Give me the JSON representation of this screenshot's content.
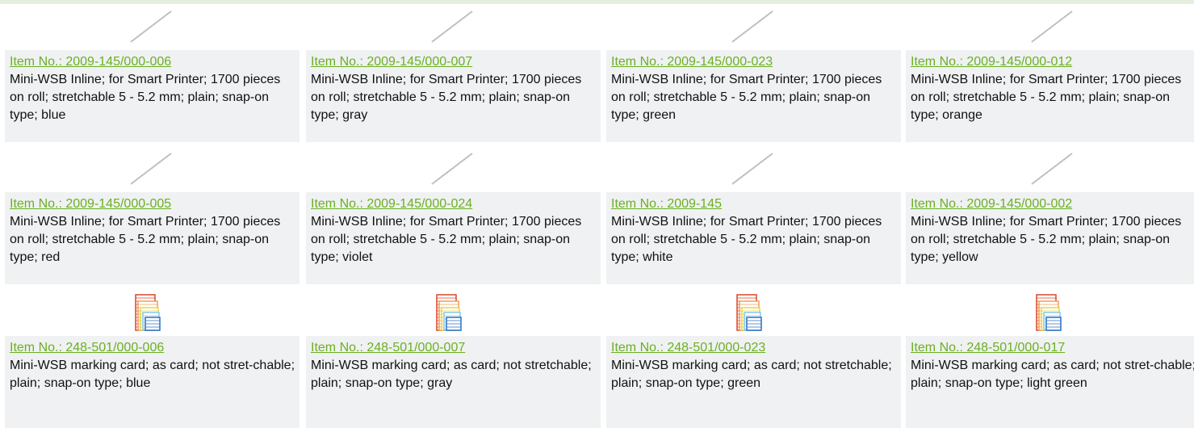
{
  "colors": {
    "link": "#6ab023",
    "card_bg": "#f0f1f2",
    "top_bar": "#e4efe0"
  },
  "products": [
    {
      "item_no": "Item No.: 2009-145/000-006",
      "description": "Mini-WSB Inline; for Smart Printer; 1700 pieces on roll; stretchable 5 - 5.2 mm; plain; snap-on type; blue",
      "thumbnail": "roll-strip-thumbnail"
    },
    {
      "item_no": "Item No.: 2009-145/000-007",
      "description": "Mini-WSB Inline; for Smart Printer; 1700 pieces on roll; stretchable 5 - 5.2 mm; plain; snap-on type; gray",
      "thumbnail": "roll-strip-thumbnail"
    },
    {
      "item_no": "Item No.: 2009-145/000-023",
      "description": "Mini-WSB Inline; for Smart Printer; 1700 pieces on roll; stretchable 5 - 5.2 mm; plain; snap-on type; green",
      "thumbnail": "roll-strip-thumbnail"
    },
    {
      "item_no": "Item No.: 2009-145/000-012",
      "description": "Mini-WSB Inline; for Smart Printer; 1700 pieces on roll; stretchable 5 - 5.2 mm; plain; snap-on type; orange",
      "thumbnail": "roll-strip-thumbnail"
    },
    {
      "item_no": "Item No.: 2009-145/000-005",
      "description": "Mini-WSB Inline; for Smart Printer; 1700 pieces on roll; stretchable 5 - 5.2 mm; plain; snap-on type; red",
      "thumbnail": "roll-strip-thumbnail"
    },
    {
      "item_no": "Item No.: 2009-145/000-024",
      "description": "Mini-WSB Inline; for Smart Printer; 1700 pieces on roll; stretchable 5 - 5.2 mm; plain; snap-on type; violet",
      "thumbnail": "roll-strip-thumbnail"
    },
    {
      "item_no": "Item No.: 2009-145",
      "description": "Mini-WSB Inline; for Smart Printer; 1700 pieces on roll; stretchable 5 - 5.2 mm; plain; snap-on type; white",
      "thumbnail": "roll-strip-thumbnail"
    },
    {
      "item_no": "Item No.: 2009-145/000-002",
      "description": "Mini-WSB Inline; for Smart Printer; 1700 pieces on roll; stretchable 5 - 5.2 mm; plain; snap-on type; yellow",
      "thumbnail": "roll-strip-thumbnail"
    },
    {
      "item_no": "Item No.: 248-501/000-006",
      "description": "Mini-WSB marking card; as card; not stret-chable; plain; snap-on type; blue",
      "thumbnail": "marking-card-thumbnail"
    },
    {
      "item_no": "Item No.: 248-501/000-007",
      "description": "Mini-WSB marking card; as card; not stretchable; plain; snap-on type; gray",
      "thumbnail": "marking-card-thumbnail"
    },
    {
      "item_no": "Item No.: 248-501/000-023",
      "description": "Mini-WSB marking card; as card; not stretchable; plain; snap-on type; green",
      "thumbnail": "marking-card-thumbnail"
    },
    {
      "item_no": "Item No.: 248-501/000-017",
      "description": "Mini-WSB marking card; as card; not stret-chable; plain; snap-on type; light green",
      "thumbnail": "marking-card-thumbnail"
    }
  ]
}
